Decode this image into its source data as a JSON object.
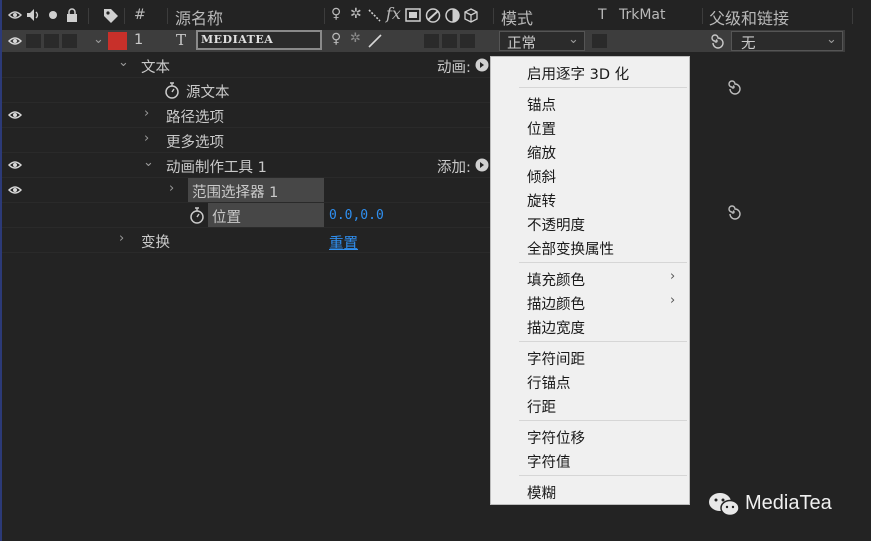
{
  "header": {
    "col_num": "#",
    "col_source": "源名称",
    "col_mode": "模式",
    "col_t": "T",
    "col_trkmat": "TrkMat",
    "col_parent": "父级和链接",
    "fx_label": "fx"
  },
  "layer": {
    "number": "1",
    "type_glyph": "T",
    "name": "MEDIATEA",
    "mode": "正常",
    "parent": "无",
    "label_color": "#c8302a"
  },
  "tree": {
    "text": "文本",
    "source_text": "源文本",
    "path_options": "路径选项",
    "more_options": "更多选项",
    "animator": "动画制作工具 1",
    "range_selector": "范围选择器 1",
    "position": "位置",
    "position_value": "0.0,0.0",
    "transform": "变换",
    "reset": "重置",
    "animate_label": "动画:",
    "add_label": "添加:"
  },
  "menu": {
    "items": [
      "启用逐字 3D 化",
      "锚点",
      "位置",
      "缩放",
      "倾斜",
      "旋转",
      "不透明度",
      "全部变换属性",
      "填充颜色",
      "描边颜色",
      "描边宽度",
      "字符间距",
      "行锚点",
      "行距",
      "字符位移",
      "字符值",
      "模糊"
    ]
  },
  "watermark": {
    "text": "MediaTea"
  },
  "colors": {
    "accent_blue": "#2f8ff0",
    "label_red": "#c8302a",
    "menu_bg": "#f0f0f0",
    "panel_bg": "#232323"
  }
}
